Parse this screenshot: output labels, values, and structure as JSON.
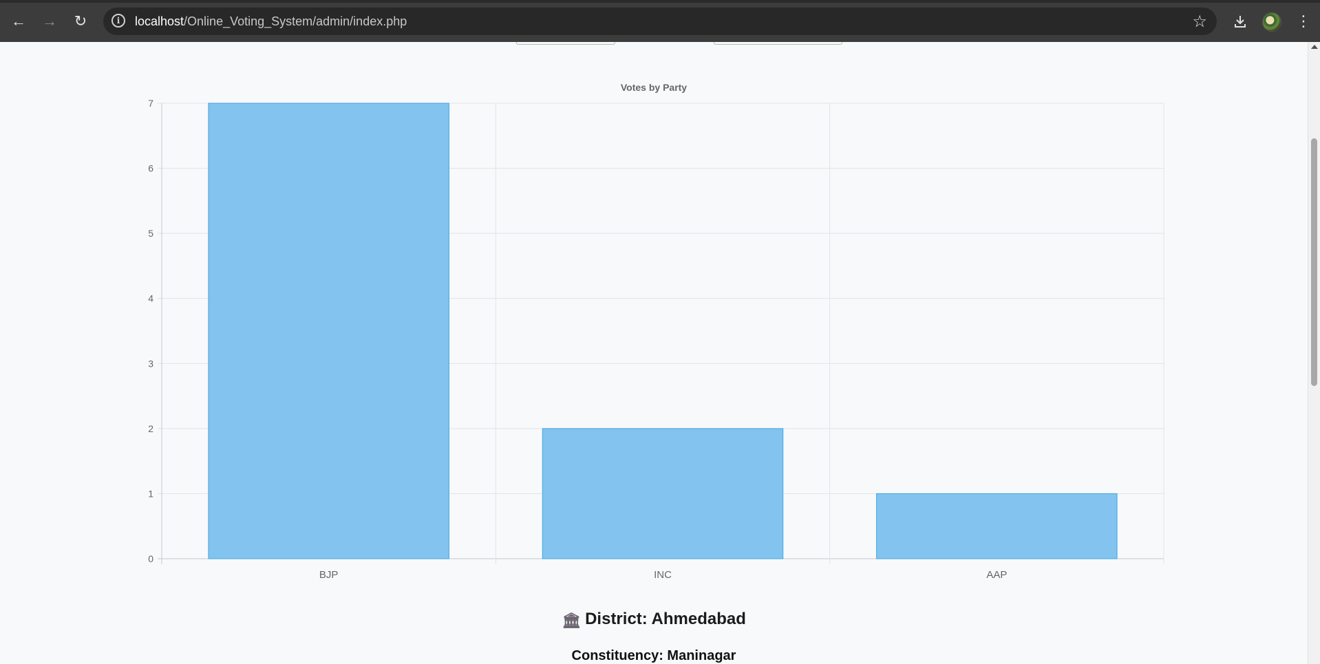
{
  "browser": {
    "url_host": "localhost",
    "url_path": "/Online_Voting_System/admin/index.php",
    "icons": {
      "back": "back-arrow-icon",
      "forward": "forward-arrow-icon",
      "reload": "reload-icon",
      "info": "site-info-icon",
      "bookmark": "star-icon",
      "download": "download-icon",
      "profile": "profile-avatar",
      "menu": "kebab-menu-icon"
    }
  },
  "chart_data": {
    "type": "bar",
    "title": "Votes by Party",
    "categories": [
      "BJP",
      "INC",
      "AAP"
    ],
    "values": [
      7,
      2,
      1
    ],
    "yticks": [
      "0",
      "1",
      "2",
      "3",
      "4",
      "5",
      "6",
      "7"
    ],
    "ylim": [
      0,
      7
    ],
    "grid": true,
    "legend": "none",
    "colors": {
      "bar_fill": "#82c4ef",
      "bar_stroke": "#45a3e0"
    }
  },
  "section": {
    "district_label": "District: Ahmedabad",
    "district_icon": "classical-building-icon",
    "constituency_label": "Constituency: Maninagar"
  }
}
